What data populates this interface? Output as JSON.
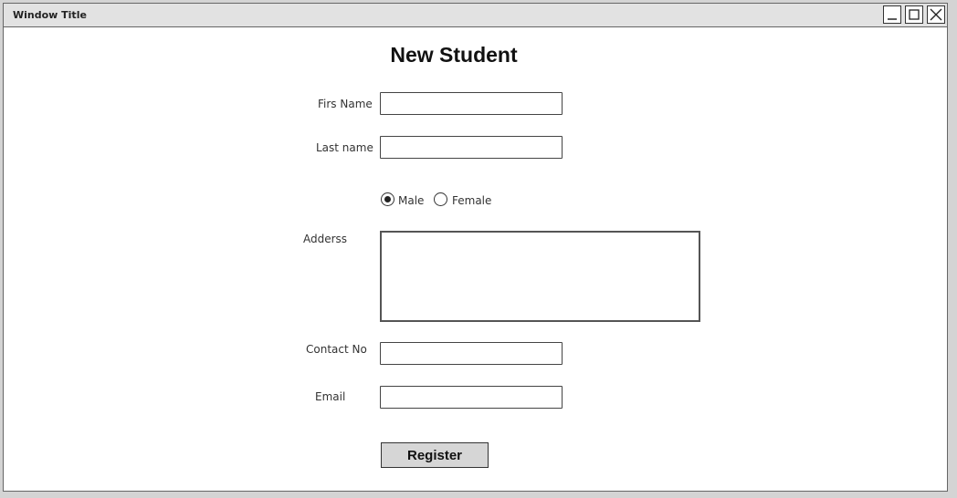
{
  "window": {
    "title": "Window Title"
  },
  "form": {
    "title": "New Student",
    "first_name": {
      "label": "Firs Name",
      "value": ""
    },
    "last_name": {
      "label": "Last name",
      "value": ""
    },
    "gender": {
      "options": [
        {
          "label": "Male",
          "checked": true
        },
        {
          "label": "Female",
          "checked": false
        }
      ]
    },
    "address": {
      "label": "Adderss",
      "value": ""
    },
    "contact": {
      "label": "Contact No",
      "value": ""
    },
    "email": {
      "label": "Email",
      "value": ""
    },
    "register_label": "Register"
  },
  "icons": {
    "minimize": "minimize-icon",
    "maximize": "maximize-icon",
    "close": "close-icon",
    "radio_checked": "radio-checked-icon",
    "radio_unchecked": "radio-unchecked-icon"
  },
  "colors": {
    "title_bar": "#e2e2e2",
    "window_bg": "#ffffff",
    "button_bg": "#d6d6d6",
    "border": "#444444"
  }
}
